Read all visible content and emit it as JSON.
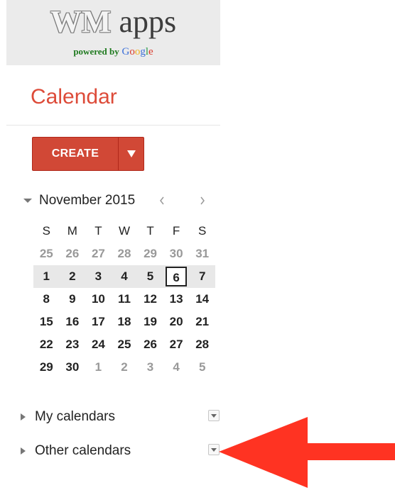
{
  "logo": {
    "brand_wm": "WM",
    "brand_apps": "apps",
    "powered_by": "powered by",
    "google": [
      "G",
      "o",
      "o",
      "g",
      "l",
      "e"
    ]
  },
  "app": {
    "title": "Calendar"
  },
  "toolbar": {
    "create_label": "CREATE",
    "create_dropdown_icon": "caret-down-icon"
  },
  "mini_calendar": {
    "month_label": "November 2015",
    "weekday_headers": [
      "S",
      "M",
      "T",
      "W",
      "T",
      "F",
      "S"
    ],
    "weeks": [
      [
        "25",
        "26",
        "27",
        "28",
        "29",
        "30",
        "31"
      ],
      [
        "1",
        "2",
        "3",
        "4",
        "5",
        "6",
        "7"
      ],
      [
        "8",
        "9",
        "10",
        "11",
        "12",
        "13",
        "14"
      ],
      [
        "15",
        "16",
        "17",
        "18",
        "19",
        "20",
        "21"
      ],
      [
        "22",
        "23",
        "24",
        "25",
        "26",
        "27",
        "28"
      ],
      [
        "29",
        "30",
        "1",
        "2",
        "3",
        "4",
        "5"
      ]
    ],
    "today": "6",
    "prev_icon": "chevron-left-icon",
    "next_icon": "chevron-right-icon"
  },
  "sections": {
    "my_calendars": "My calendars",
    "other_calendars": "Other calendars"
  },
  "colors": {
    "accent_red": "#dd4b39",
    "button_red": "#d14836",
    "annotation_arrow": "#ff3322"
  }
}
